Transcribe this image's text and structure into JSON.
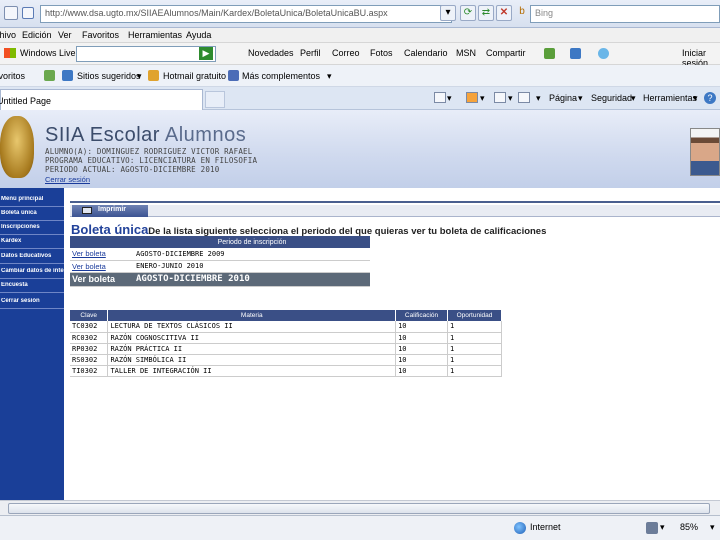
{
  "browser": {
    "url": "http://www.dsa.ugto.mx/SIIAEAlumnos/Main/Kardex/BoletaUnica/BoletaUnicaBU.aspx",
    "search_placeholder": "Bing",
    "menu": [
      "Archivo",
      "Edición",
      "Ver",
      "Favoritos",
      "Herramientas",
      "Ayuda"
    ],
    "live": {
      "brand": "Windows Live",
      "links": [
        "Novedades",
        "Perfil",
        "Correo",
        "Fotos",
        "Calendario",
        "MSN",
        "Compartir"
      ],
      "sign_in": "Iniciar sesión"
    },
    "favorites": {
      "label": "Favoritos",
      "items": [
        "Sitios sugeridos",
        "Hotmail gratuito",
        "Más complementos"
      ]
    },
    "tab_title": "Untitled Page",
    "tools": [
      "Página",
      "Seguridad",
      "Herramientas"
    ],
    "status": {
      "zone": "Internet",
      "zoom": "85%"
    }
  },
  "app": {
    "title": "SIIA Escolar",
    "title_suffix": "Alumnos",
    "student_label": "ALUMNO(A): DOMINGUEZ RODRIGUEZ VICTOR RAFAEL",
    "program_label": "PROGRAMA EDUCATIVO: LICENCIATURA EN FILOSOFIA",
    "period_label": "PERIODO ACTUAL: AGOSTO-DICIEMBRE 2010",
    "logout": "Cerrar sesión"
  },
  "sidebar": {
    "items": [
      "Menú principal",
      "Boleta única",
      "Inscripciones",
      "Kardex",
      "Datos Educativos",
      "Cambiar datos de interés",
      "Encuesta",
      "Cerrar sesión"
    ]
  },
  "toolbar": {
    "print_label": "Imprimir"
  },
  "section": {
    "title": "Boleta única",
    "instruction": "De la lista siguiente selecciona el periodo del que quieras ver tu boleta de calificaciones"
  },
  "periods": {
    "header": "Periodo de inscripción",
    "rows": [
      {
        "link": "Ver boleta",
        "period": "AGOSTO-DICIEMBRE 2009"
      },
      {
        "link": "Ver boleta",
        "period": "ENERO-JUNIO 2010"
      },
      {
        "link": "Ver boleta",
        "period": "AGOSTO-DICIEMBRE 2010"
      }
    ]
  },
  "grades": {
    "headers": [
      "Clave",
      "Materia",
      "Calificación",
      "Oportunidad"
    ],
    "rows": [
      [
        "TC0302",
        "LECTURA DE TEXTOS CLÁSICOS II",
        "10",
        "1"
      ],
      [
        "RC0302",
        "RAZÓN COGNOSCITIVA II",
        "10",
        "1"
      ],
      [
        "RP0302",
        "RAZÓN PRÁCTICA II",
        "10",
        "1"
      ],
      [
        "RS0302",
        "RAZÓN SIMBÓLICA II",
        "10",
        "1"
      ],
      [
        "TI0302",
        "TALLER DE INTEGRACIÓN II",
        "10",
        "1"
      ]
    ]
  }
}
